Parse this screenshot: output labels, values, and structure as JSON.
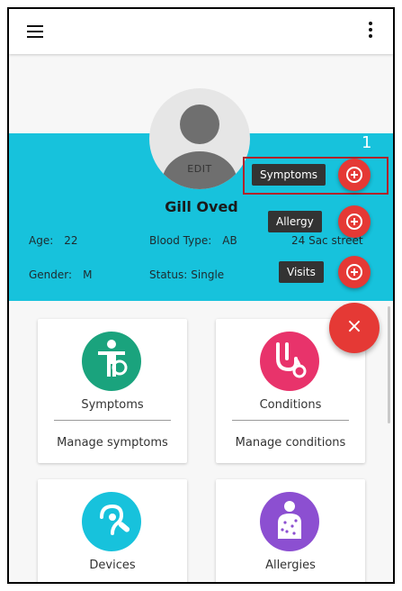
{
  "topbar": {
    "menu_icon": "hamburger-icon",
    "more_icon": "kebab-menu-icon"
  },
  "profile": {
    "edit_label": "EDIT",
    "name": "Gill Oved",
    "age_label": "Age:",
    "age_value": "22",
    "blood_label": "Blood Type:",
    "blood_value": "AB",
    "address": "24 Sac street",
    "gender_label": "Gender:",
    "gender_value": "M",
    "status_label": "Status:",
    "status_value": "Single"
  },
  "speed_dial": {
    "step_number": "1",
    "items": [
      {
        "label": "Symptoms",
        "icon": "add-circle-icon"
      },
      {
        "label": "Allergy",
        "icon": "add-circle-icon"
      },
      {
        "label": "Visits",
        "icon": "add-circle-icon"
      }
    ],
    "close_glyph": "×",
    "colors": {
      "fab": "#e53935",
      "highlight": "#b0232a"
    }
  },
  "cards": [
    {
      "title": "Symptoms",
      "action": "Manage symptoms",
      "icon": "symptoms-icon",
      "color": "#1aa37d"
    },
    {
      "title": "Conditions",
      "action": "Manage conditions",
      "icon": "stethoscope-icon",
      "color": "#e8336b"
    },
    {
      "title": "Devices",
      "action": "",
      "icon": "hearing-device-icon",
      "color": "#17c2dc"
    },
    {
      "title": "Allergies",
      "action": "",
      "icon": "allergy-body-icon",
      "color": "#8c4fd1"
    }
  ],
  "colors": {
    "header": "#17c2dc",
    "background": "#f7f7f7"
  }
}
